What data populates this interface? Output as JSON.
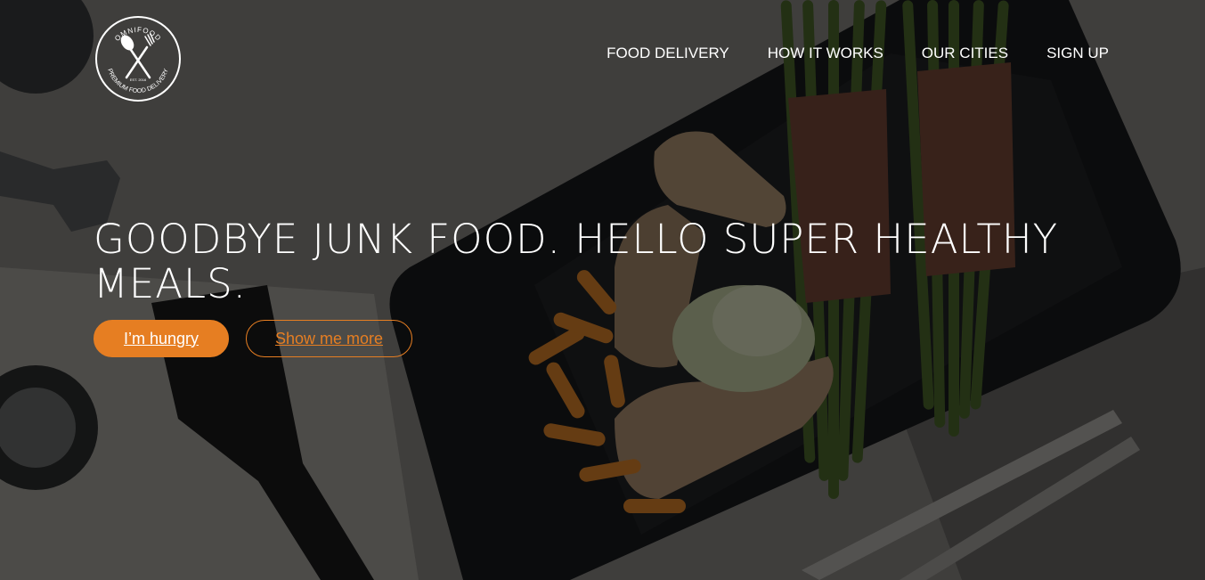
{
  "brand": {
    "logo_top_text": "OMNIFOOD",
    "logo_bottom_text": "PREMIUM FOOD DELIVERY",
    "logo_est_text": "EST. 2016",
    "logo_icon": "fork-spoon-crossed-icon"
  },
  "nav": {
    "items": [
      {
        "label": "FOOD DELIVERY"
      },
      {
        "label": "HOW IT WORKS"
      },
      {
        "label": "OUR CITIES"
      },
      {
        "label": "SIGN UP"
      }
    ]
  },
  "hero": {
    "headline_line1": "GOODBYE JUNK FOOD. HELLO SUPER HEALTHY",
    "headline_line2": "MEALS.",
    "primary_button": "I’m hungry",
    "secondary_button": "Show me more"
  },
  "colors": {
    "accent": "#e67e22",
    "text": "#ffffff"
  }
}
